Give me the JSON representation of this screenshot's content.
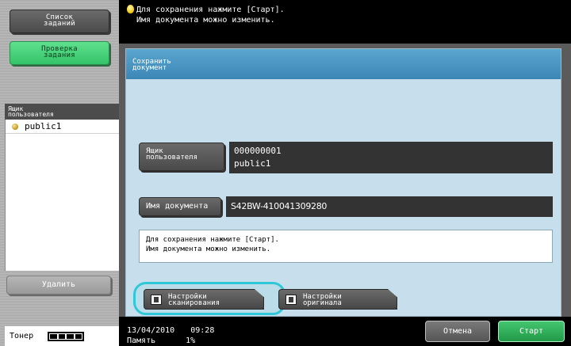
{
  "left": {
    "job_list_label": "Список\nзаданий",
    "job_check_label": "Проверка\nзадания",
    "box_header": "Ящик\nпользователя",
    "box_item": "public1",
    "delete_label": "Удалить",
    "toner_label": "Тонер",
    "toner_segments": 4
  },
  "top_message": {
    "line1": "Для сохранения нажмите [Старт].",
    "line2": "Имя документа можно изменить."
  },
  "main": {
    "title": "Сохранить\nдокумент",
    "user_box_button": "Ящик\nпользователя",
    "user_box_number": "000000001",
    "user_box_name": "public1",
    "doc_name_button": "Имя документа",
    "doc_name_value": "S42BW-410041309280",
    "message_line1": "Для сохранения нажмите [Старт].",
    "message_line2": "Имя документа можно изменить.",
    "scan_settings_label": "Настройки\nсканирования",
    "original_settings_label": "Настройки\nоригинала"
  },
  "status": {
    "date": "13/04/2010",
    "time": "09:28",
    "memory_label": "Память",
    "memory_value": "1%"
  },
  "actions": {
    "cancel_label": "Отмена",
    "start_label": "Старт"
  },
  "colors": {
    "accent_green": "#34c468",
    "highlight_cyan": "#2ec8d8",
    "title_blue": "#3c86b6"
  }
}
